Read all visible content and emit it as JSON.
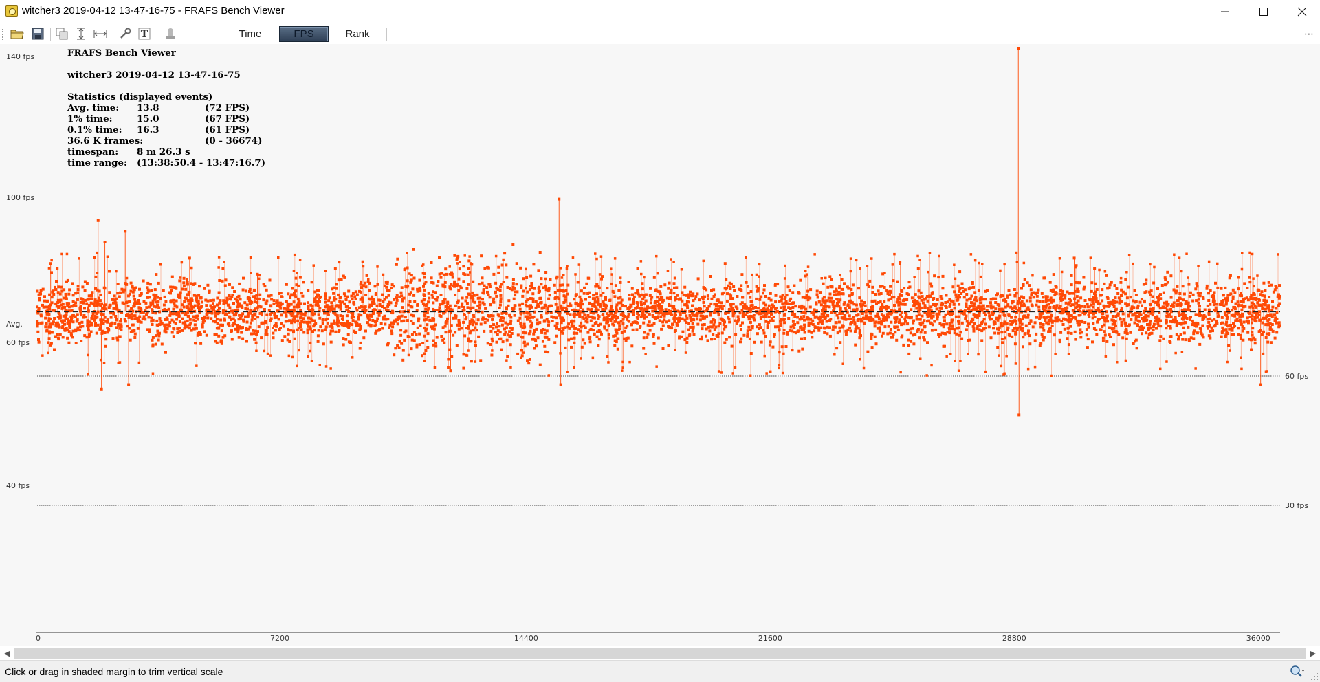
{
  "window": {
    "title": "witcher3 2019-04-12 13-47-16-75 - FRAFS Bench Viewer"
  },
  "toolbar": {
    "icons": [
      "open-folder-icon",
      "save-icon",
      "copy-icon",
      "fit-vertical-icon",
      "fit-horizontal-icon",
      "wrench-icon",
      "text-icon",
      "stamp-icon"
    ],
    "tabs": [
      "Time",
      "FPS",
      "Rank"
    ],
    "active_tab": "FPS",
    "overflow": "⋯"
  },
  "stats": {
    "app_name": "FRAFS Bench Viewer",
    "file_name": "witcher3 2019-04-12 13-47-16-75",
    "heading": "Statistics (displayed events)",
    "rows": [
      {
        "label": "Avg. time:",
        "value": "13.8",
        "extra": "(72 FPS)"
      },
      {
        "label": "1% time:",
        "value": "15.0",
        "extra": "(67 FPS)"
      },
      {
        "label": "0.1% time:",
        "value": "16.3",
        "extra": "(61 FPS)"
      },
      {
        "label": "36.6 K frames:",
        "value": "",
        "extra": "(0 - 36674)"
      },
      {
        "label": "timespan:",
        "value": "8 m 26.3 s",
        "extra": ""
      },
      {
        "label": "time range:",
        "value": "(13:38:50.4 - 13:47:16.7)",
        "extra": ""
      }
    ]
  },
  "chart_data": {
    "type": "scatter",
    "x_min": 0,
    "x_max": 36674,
    "x_ticks": [
      0,
      7200,
      14400,
      21600,
      28800,
      36000
    ],
    "x_tick_labels": [
      "0",
      "7200",
      "14400",
      "21600",
      "28800",
      "36000"
    ],
    "left_labels": [
      "140 fps",
      "100 fps",
      "Avg.",
      "60 fps",
      "40 fps"
    ],
    "right_labels": [
      "60 fps",
      "30 fps"
    ],
    "avg_fps": 72,
    "band_fps": [
      68,
      76
    ],
    "spikes": [
      {
        "x": 400,
        "fps": 81
      },
      {
        "x": 1800,
        "fps": 89
      },
      {
        "x": 1900,
        "fps": 57
      },
      {
        "x": 2000,
        "fps": 85
      },
      {
        "x": 2600,
        "fps": 87
      },
      {
        "x": 2700,
        "fps": 58
      },
      {
        "x": 4500,
        "fps": 82
      },
      {
        "x": 6500,
        "fps": 79
      },
      {
        "x": 8800,
        "fps": 80
      },
      {
        "x": 12200,
        "fps": 61
      },
      {
        "x": 12800,
        "fps": 81
      },
      {
        "x": 15400,
        "fps": 93
      },
      {
        "x": 15450,
        "fps": 58
      },
      {
        "x": 20300,
        "fps": 81
      },
      {
        "x": 26000,
        "fps": 80
      },
      {
        "x": 28950,
        "fps": 140
      },
      {
        "x": 28970,
        "fps": 51
      },
      {
        "x": 30600,
        "fps": 82
      },
      {
        "x": 31200,
        "fps": 80
      },
      {
        "x": 36100,
        "fps": 58
      }
    ],
    "colors": {
      "points": "#ff4a06",
      "avg_line": "#222222",
      "ref_line": "#444444",
      "background": "#f7f7f7"
    }
  },
  "statusbar": {
    "text": "Click or drag in shaded margin to trim vertical scale"
  }
}
